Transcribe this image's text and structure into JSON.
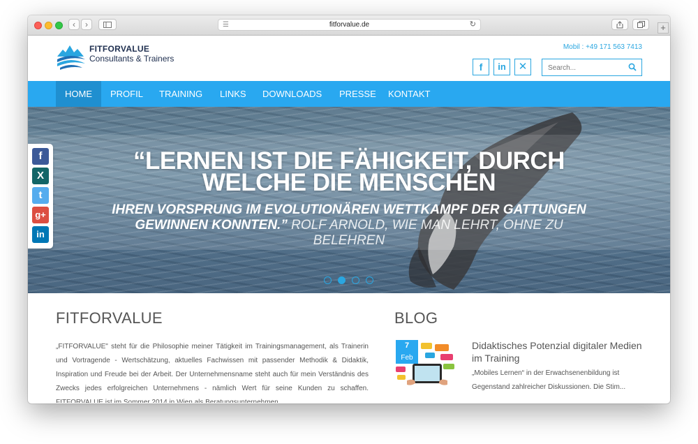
{
  "browser": {
    "url": "fitforvalue.de",
    "menu_icon": "reader-icon",
    "reload_icon": "reload-icon",
    "back_glyph": "‹",
    "forward_glyph": "›",
    "plus_glyph": "+"
  },
  "header": {
    "logo_line1": "FITFORVALUE",
    "logo_line2": "Consultants & Trainers",
    "phone": "Mobil : +49 171 563 7413",
    "social": [
      "f",
      "in",
      "✕"
    ],
    "search_placeholder": "Search..."
  },
  "nav": {
    "items": [
      {
        "label": "HOME",
        "active": true
      },
      {
        "label": "PROFIL"
      },
      {
        "label": "TRAINING"
      },
      {
        "label": "LINKS"
      },
      {
        "label": "DOWNLOADS"
      },
      {
        "label": "PRESSE"
      },
      {
        "label": "KONTAKT"
      }
    ]
  },
  "hero": {
    "quote_line1": "“LERNEN IST DIE FÄHIGKEIT, DURCH",
    "quote_line2": "WELCHE DIE MENSCHEN",
    "quote_line3": "IHREN VORSPRUNG IM EVOLUTIONÄREN WETTKAMPF DER GATTUNGEN GEWINNEN KONNTEN.”",
    "attribution": "ROLF ARNOLD, WIE MAN LEHRT, OHNE ZU BELEHREN",
    "slides": 4,
    "active_slide": 2
  },
  "share": {
    "items": [
      {
        "name": "facebook",
        "glyph": "f",
        "color": "#3b5998"
      },
      {
        "name": "xing",
        "glyph": "X",
        "color": "#126567"
      },
      {
        "name": "twitter",
        "glyph": "t",
        "color": "#55acee"
      },
      {
        "name": "google-plus",
        "glyph": "g+",
        "color": "#dc4e41"
      },
      {
        "name": "linkedin",
        "glyph": "in",
        "color": "#0077b5"
      }
    ]
  },
  "main": {
    "title": "FITFORVALUE",
    "text": "„FITFORVALUE\" steht für die Philosophie meiner Tätigkeit im Trainingsmanagement, als Trainerin und Vortragende - Wertschätzung, aktuelles Fachwissen mit passender Methodik & Didaktik, Inspiration und Freude bei der Arbeit. Der Unternehmensname steht auch für mein Verständnis des Zwecks jedes erfolgreichen Unternehmens - nämlich Wert für seine Kunden zu schaffen. FITFORVALUE ist im Sommer 2014 in Wien als Beratungsunternehmen"
  },
  "blog": {
    "title": "BLOG",
    "post": {
      "day": "7",
      "month": "Feb",
      "title": "Didaktisches Potenzial digitaler Medien im Training",
      "excerpt": "„Mobiles Lernen“ in der Erwachsenenbildung ist Gegenstand zahlreicher Diskussionen. Die Stim..."
    }
  },
  "colors": {
    "accent": "#29a8f0",
    "accent_dark": "#1f8fd0",
    "text": "#555555"
  }
}
